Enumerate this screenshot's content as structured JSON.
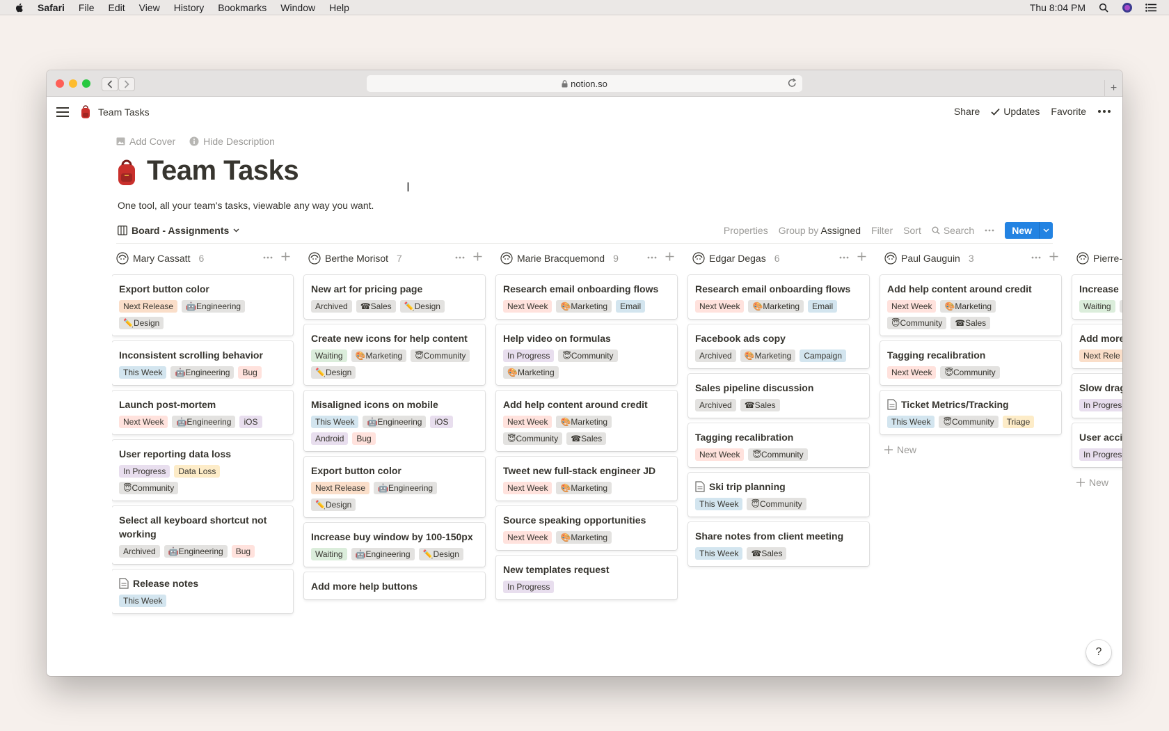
{
  "menubar": {
    "app": "Safari",
    "items": [
      "File",
      "Edit",
      "View",
      "History",
      "Bookmarks",
      "Window",
      "Help"
    ],
    "clock": "Thu 8:04 PM"
  },
  "browser": {
    "url": "notion.so"
  },
  "topbar": {
    "breadcrumb": "Team Tasks",
    "share": "Share",
    "updates": "Updates",
    "favorite": "Favorite"
  },
  "page": {
    "add_cover": "Add Cover",
    "hide_description": "Hide Description",
    "title": "Team Tasks",
    "description": "One tool, all your team's tasks, viewable any way you want."
  },
  "view": {
    "name": "Board - Assignments",
    "properties": "Properties",
    "group_by_label": "Group by",
    "group_by_value": "Assigned",
    "filter": "Filter",
    "sort": "Sort",
    "search": "Search",
    "new": "New"
  },
  "tag_colors": {
    "Next Release": "#fadec9",
    "Next Week": "#ffe2dd",
    "This Week": "#d3e5ef",
    "In Progress": "#e8deee",
    "Archived": "#e3e2e0",
    "Waiting": "#dbeddb",
    "Engineering": "#e3e2e0",
    "Design": "#e3e2e0",
    "Bug": "#ffe2dd",
    "iOS": "#e8deee",
    "Android": "#e8deee",
    "Data Loss": "#fdecc8",
    "Community": "#e3e2e0",
    "Sales": "#e3e2e0",
    "Marketing": "#e3e2e0",
    "Email": "#d3e5ef",
    "Campaign": "#d3e5ef",
    "Triage": "#fdecc8"
  },
  "tag_icons": {
    "Engineering": "🤖",
    "Design": "✏️",
    "Community": "😇",
    "Sales": "☎",
    "Marketing": "🎨"
  },
  "columns": [
    {
      "name": "Mary Cassatt",
      "count": "6",
      "avatar": "avatar-mary-icon",
      "cards": [
        {
          "title": "Export button color",
          "tags": [
            "Next Release",
            "Engineering",
            "Design"
          ]
        },
        {
          "title": "Inconsistent scrolling behavior",
          "tags": [
            "This Week",
            "Engineering",
            "Bug"
          ]
        },
        {
          "title": "Launch post-mortem",
          "tags": [
            "Next Week",
            "Engineering",
            "iOS"
          ]
        },
        {
          "title": "User reporting data loss",
          "tags": [
            "In Progress",
            "Data Loss",
            "Community"
          ]
        },
        {
          "title": "Select all keyboard shortcut not working",
          "tags": [
            "Archived",
            "Engineering",
            "Bug"
          ]
        },
        {
          "title": "Release notes",
          "doc": true,
          "tags": [
            "This Week"
          ]
        }
      ]
    },
    {
      "name": "Berthe Morisot",
      "count": "7",
      "avatar": "avatar-berthe-icon",
      "cards": [
        {
          "title": "New art for pricing page",
          "tags": [
            "Archived",
            "Sales",
            "Design"
          ]
        },
        {
          "title": "Create new icons for help content",
          "tags": [
            "Waiting",
            "Marketing",
            "Community",
            "Design"
          ]
        },
        {
          "title": "Misaligned icons on mobile",
          "tags": [
            "This Week",
            "Engineering",
            "iOS",
            "Android",
            "Bug"
          ]
        },
        {
          "title": "Export button color",
          "tags": [
            "Next Release",
            "Engineering",
            "Design"
          ]
        },
        {
          "title": "Increase buy window by 100-150px",
          "tags": [
            "Waiting",
            "Engineering",
            "Design"
          ]
        },
        {
          "title": "Add more help buttons",
          "tags": []
        }
      ]
    },
    {
      "name": "Marie Bracquemond",
      "count": "9",
      "avatar": "avatar-marie-icon",
      "cards": [
        {
          "title": "Research email onboarding flows",
          "tags": [
            "Next Week",
            "Marketing",
            "Email"
          ]
        },
        {
          "title": "Help video on formulas",
          "tags": [
            "In Progress",
            "Community",
            "Marketing"
          ]
        },
        {
          "title": "Add help content around credit",
          "tags": [
            "Next Week",
            "Marketing",
            "Community",
            "Sales"
          ]
        },
        {
          "title": "Tweet new full-stack engineer JD",
          "tags": [
            "Next Week",
            "Marketing"
          ]
        },
        {
          "title": "Source speaking opportunities",
          "tags": [
            "Next Week",
            "Marketing"
          ]
        },
        {
          "title": "New templates request",
          "tags": [
            "In Progress"
          ]
        }
      ]
    },
    {
      "name": "Edgar Degas",
      "count": "6",
      "avatar": "avatar-edgar-icon",
      "cards": [
        {
          "title": "Research email onboarding flows",
          "tags": [
            "Next Week",
            "Marketing",
            "Email"
          ]
        },
        {
          "title": "Facebook ads copy",
          "tags": [
            "Archived",
            "Marketing",
            "Campaign"
          ]
        },
        {
          "title": "Sales pipeline discussion",
          "tags": [
            "Archived",
            "Sales"
          ]
        },
        {
          "title": "Tagging recalibration",
          "tags": [
            "Next Week",
            "Community"
          ]
        },
        {
          "title": "Ski trip planning",
          "doc": true,
          "tags": [
            "This Week",
            "Community"
          ]
        },
        {
          "title": "Share notes from client meeting",
          "tags": [
            "This Week",
            "Sales"
          ]
        }
      ]
    },
    {
      "name": "Paul Gauguin",
      "count": "3",
      "avatar": "avatar-paul-icon",
      "cards": [
        {
          "title": "Add help content around credit",
          "tags": [
            "Next Week",
            "Marketing",
            "Community",
            "Sales"
          ]
        },
        {
          "title": "Tagging recalibration",
          "tags": [
            "Next Week",
            "Community"
          ]
        },
        {
          "title": "Ticket Metrics/Tracking",
          "doc": true,
          "tags": [
            "This Week",
            "Community",
            "Triage"
          ]
        }
      ],
      "new_label": "New"
    },
    {
      "name": "Pierre-",
      "count": "",
      "avatar": "avatar-pierre-icon",
      "cards": [
        {
          "title": "Increase",
          "tags": [
            "Waiting",
            "Engine"
          ]
        },
        {
          "title": "Add more",
          "tags": [
            "Next Rele",
            "Engine"
          ]
        },
        {
          "title": "Slow drag",
          "tags": [
            "In Progres",
            "Engine"
          ]
        },
        {
          "title": "User acci",
          "tags": [
            "In Progres",
            "Comm"
          ]
        }
      ],
      "new_label": "New"
    }
  ],
  "help": "?"
}
